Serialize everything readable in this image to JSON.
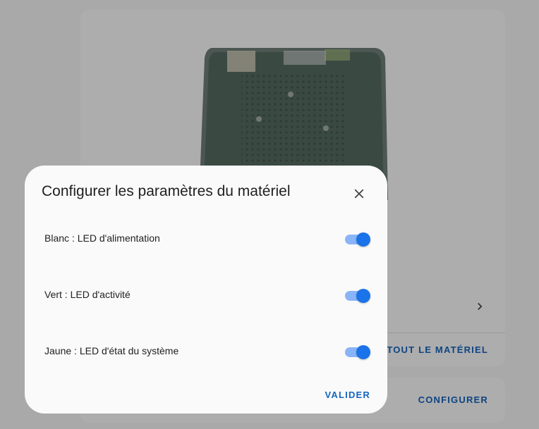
{
  "background": {
    "all_hardware_label": "TOUT LE MATÉRIEL",
    "configure_label": "CONFIGURER"
  },
  "dialog": {
    "title": "Configurer les paramètres du matériel",
    "settings": [
      {
        "label": "Blanc : LED d'alimentation",
        "enabled": true
      },
      {
        "label": "Vert : LED d'activité",
        "enabled": true
      },
      {
        "label": "Jaune : LED d'état du système",
        "enabled": true
      }
    ],
    "validate_label": "VALIDER"
  },
  "colors": {
    "accent": "#1a73e8",
    "accent_track": "#8ab4f8",
    "link": "#1565c0"
  }
}
